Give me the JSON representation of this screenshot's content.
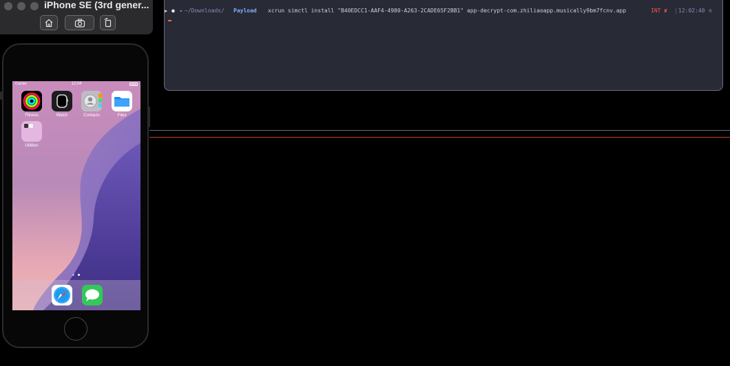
{
  "simulator": {
    "title": "iPhone SE (3rd gener...",
    "toolbar": [
      {
        "icon": "home-icon"
      },
      {
        "icon": "screenshot-icon"
      },
      {
        "icon": "rotate-icon"
      }
    ]
  },
  "phone": {
    "status": {
      "carrier": "Carrier",
      "time": "12:04"
    },
    "apps": [
      {
        "label": "Fitness",
        "icon": "fitness-icon"
      },
      {
        "label": "Watch",
        "icon": "watch-icon"
      },
      {
        "label": "Contacts",
        "icon": "contacts-icon"
      },
      {
        "label": "Files",
        "icon": "files-icon"
      },
      {
        "label": "Utilities",
        "icon": "folder-icon"
      }
    ],
    "page_count": 2,
    "active_page": 2,
    "dock": [
      {
        "icon": "safari-icon"
      },
      {
        "icon": "messages-icon"
      }
    ]
  },
  "terminal": {
    "path_prefix": "~/Downloads/",
    "path_dir": "Payload",
    "command": "xcrun simctl install \"B40EDCC1-AAF4-4980-A263-2CADE65F2BB1\" app-decrypt-com.zhiliaoapp.musically9bm7fcnv.app",
    "status": "INT ✘",
    "time": "12:02:40",
    "colors": {
      "bg": "#282a36",
      "path": "#8b8fb8",
      "dir": "#7fb0ff",
      "error": "#ff5555",
      "cursor": "#ff6a3d"
    }
  }
}
